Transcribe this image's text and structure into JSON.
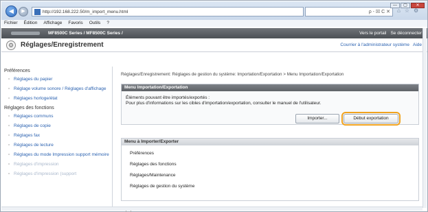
{
  "browser": {
    "address": "http://192.168.222.50/m_import_menu.html",
    "search_glyphs": "ρ - ☒ C ✕",
    "window_buttons": [
      "—",
      "▢",
      "✕"
    ]
  },
  "menubar": [
    "Fichier",
    "Édition",
    "Affichage",
    "Favoris",
    "Outils",
    "?"
  ],
  "app": {
    "model": "MF8500C Series / MF8500C Series /",
    "portal_link": "Vers le portail",
    "logout_link": "Se déconnecter",
    "page_title": "Réglages/Enregistrement",
    "mail_admin": "Courrier à l'administrateur système",
    "help": "Aide"
  },
  "sidebar": {
    "sections": [
      {
        "title": "Préférences",
        "items": [
          "Réglages du papier",
          "Réglage volume sonore / Réglages d'affichage",
          "Réglages horloge/état"
        ]
      },
      {
        "title": "Réglages des fonctions",
        "items": [
          "Réglages communs",
          "Réglages de copie",
          "Réglages fax",
          "Réglages de lecture",
          "Réglages du mode Impression support mémoire",
          "Réglages d'impression",
          "Réglages d'impression (support"
        ]
      }
    ]
  },
  "main": {
    "breadcrumb": "Réglages/Enregistrement: Réglages de gestion du système: Importation/Exportation > Menu Importation/Exportation",
    "panel1": {
      "header": "Menu Importation/Exportation",
      "line1": "Éléments pouvant être importés/exportés :",
      "line2": "Pour plus d'informations sur les cibles d'importation/exportation, consulter le manuel de l'utilisateur.",
      "import_label": "Importer...",
      "export_label": "Début exportation"
    },
    "panel2": {
      "header": "Menu à Importer/Exporter",
      "items": [
        "Préférences",
        "Réglages des fonctions",
        "Réglages/Maintenance",
        "Réglages de gestion du système"
      ]
    }
  },
  "colors": {
    "highlight": "#f0a21e",
    "link": "#2b62b0",
    "header_bg": "#5e6267"
  }
}
